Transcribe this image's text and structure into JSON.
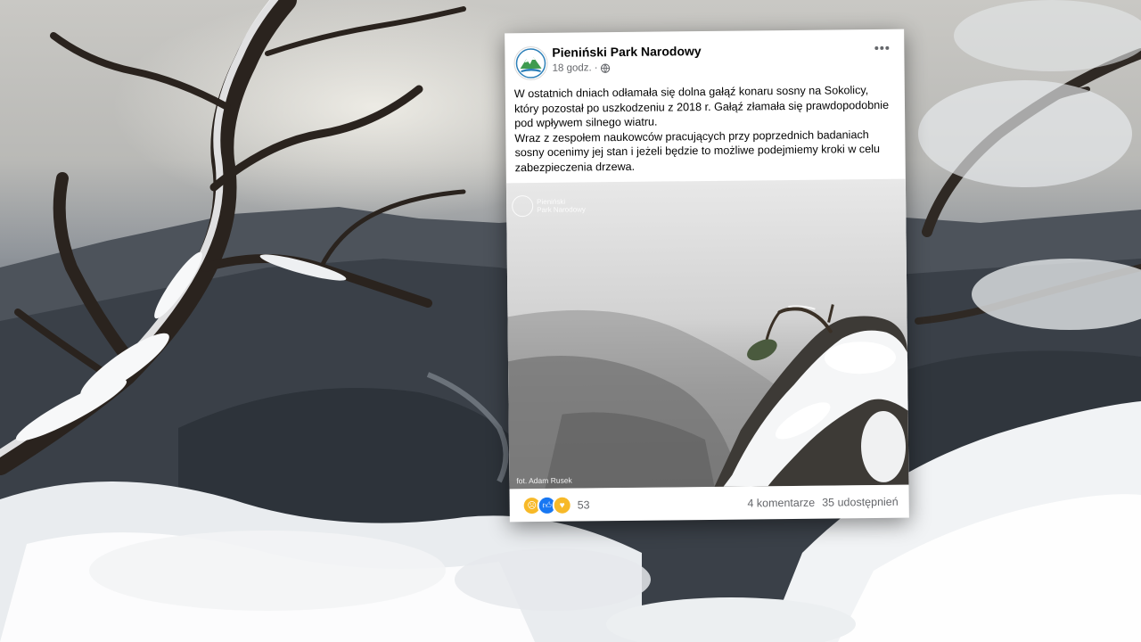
{
  "post": {
    "page_name": "Pieniński Park Narodowy",
    "time": "18 godz.",
    "separator": "·",
    "audience_icon": "globe-icon",
    "more_icon": "more-options-icon",
    "text": {
      "paragraph1": "W ostatnich dniach odłamała się dolna gałąź konaru sosny na Sokolicy, który pozostał po uszkodzeniu z 2018 r. Gałąź złamała się prawdopodobnie pod wpływem silnego wiatru.",
      "paragraph2": "Wraz z zespołem naukowców pracujących przy poprzednich badaniach sosny ocenimy jej stan i jeżeli będzie to możliwe podejmiemy kroki w celu zabezpieczenia drzewa."
    },
    "photo": {
      "watermark_line1": "Pieniński",
      "watermark_line2": "Park Narodowy",
      "credit": "fot. Adam Rusek"
    },
    "reactions": {
      "icons": [
        "sad-reaction-icon",
        "like-reaction-icon",
        "care-reaction-icon"
      ],
      "count": "53"
    },
    "comments": "4 komentarze",
    "shares": "35 udostępnień"
  },
  "colors": {
    "facebook_blue": "#1877f2",
    "text_primary": "#050505",
    "text_secondary": "#65676b"
  }
}
